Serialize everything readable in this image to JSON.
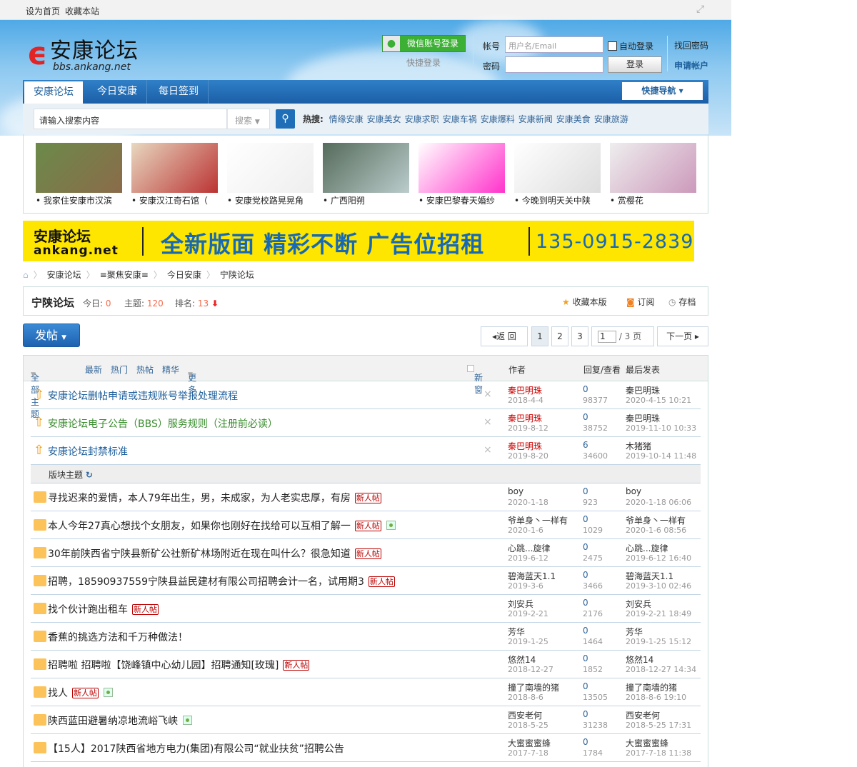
{
  "topbar": {
    "set_home": "设为首页",
    "bookmark": "收藏本站"
  },
  "logo": {
    "name": "安康论坛",
    "url": "bbs.ankang.net"
  },
  "login": {
    "wechat": "微信账号登录",
    "quick": "快捷登录",
    "account_label": "帐号",
    "account_placeholder": "用户名/Email",
    "password_label": "密码",
    "auto_login": "自动登录",
    "login_btn": "登录",
    "find_pw": "找回密码",
    "register": "申请帐户"
  },
  "nav": {
    "tabs": [
      "安康论坛",
      "今日安康",
      "每日签到"
    ],
    "quick_nav": "快捷导航"
  },
  "search": {
    "placeholder": "请输入搜索内容",
    "type": "搜索",
    "hot_label": "热搜:",
    "hot": [
      "情缘安康",
      "安康美女",
      "安康求职",
      "安康车祸",
      "安康爆料",
      "安康新闻",
      "安康美食",
      "安康旅游"
    ]
  },
  "slides": [
    "我家住安康市汉滨",
    "安康汉江奇石馆（",
    "安康党校路晃晃角",
    "广西阳朔",
    "安康巴黎春天婚纱",
    "今晚到明天关中陕",
    "赏樱花"
  ],
  "ad": {
    "logo": "安康论坛",
    "logo_url": "ankang.net",
    "text": "全新版面  精彩不断  广告位招租",
    "phone": "135-0915-2839"
  },
  "breadcrumb": [
    "安康论坛",
    "≡聚焦安康≡",
    "今日安康",
    "宁陕论坛"
  ],
  "forum": {
    "name": "宁陕论坛",
    "today_label": "今日:",
    "today": "0",
    "topics_label": "主题:",
    "topics": "120",
    "rank_label": "排名:",
    "rank": "13",
    "fav": "收藏本版",
    "rss": "订阅",
    "archive": "存档"
  },
  "post_btn": "发帖",
  "pager": {
    "back": "返 回",
    "pages": [
      "1",
      "2",
      "3"
    ],
    "current": "1",
    "total": "/ 3 页",
    "next": "下一页"
  },
  "thead": {
    "filters": [
      "全部主题",
      "最新",
      "热门",
      "热帖",
      "精华",
      "更多"
    ],
    "new_window": "新窗",
    "author": "作者",
    "replies": "回复/查看",
    "last": "最后发表"
  },
  "section_label": "版块主题",
  "sticky": [
    {
      "title": "安康论坛删帖申请或违规账号举报处理流程",
      "style": "hl",
      "author": "秦巴明珠",
      "date": "2018-4-4",
      "replies": "0",
      "views": "98377",
      "last_user": "秦巴明珠",
      "last_time": "2020-4-15 10:21"
    },
    {
      "title": "安康论坛电子公告（BBS）服务规则（注册前必读）",
      "style": "gr",
      "author": "秦巴明珠",
      "date": "2019-8-12",
      "replies": "0",
      "views": "38752",
      "last_user": "秦巴明珠",
      "last_time": "2019-11-10 10:33"
    },
    {
      "title": "安康论坛封禁标准",
      "style": "hl",
      "author": "秦巴明珠",
      "date": "2019-8-20",
      "replies": "6",
      "views": "34600",
      "last_user": "木猪猪",
      "last_time": "2019-10-14 11:48"
    }
  ],
  "new_badge": "新人帖",
  "threads": [
    {
      "title": "寻找迟来的爱情，本人79年出生，男，未成家，为人老实忠厚，有房",
      "new": true,
      "img": false,
      "author": "boy",
      "date": "2020-1-18",
      "replies": "0",
      "views": "923",
      "last_user": "boy",
      "last_time": "2020-1-18 06:06"
    },
    {
      "title": "本人今年27真心想找个女朋友，如果你也刚好在找给可以互相了解一",
      "new": true,
      "img": true,
      "author": "爷单身丶一样有",
      "date": "2020-1-6",
      "replies": "0",
      "views": "1029",
      "last_user": "爷单身丶一样有",
      "last_time": "2020-1-6 08:56"
    },
    {
      "title": "30年前陕西省宁陕县新矿公社新矿林场附近在现在叫什么？很急知道",
      "new": true,
      "img": false,
      "author": "心跳...旋律",
      "date": "2019-6-12",
      "replies": "0",
      "views": "2475",
      "last_user": "心跳...旋律",
      "last_time": "2019-6-12 16:40"
    },
    {
      "title": "招聘，18590937559宁陕县益民建材有限公司招聘会计一名，试用期3",
      "new": true,
      "img": false,
      "author": "碧海蓝天1.1",
      "date": "2019-3-6",
      "replies": "0",
      "views": "3466",
      "last_user": "碧海蓝天1.1",
      "last_time": "2019-3-10 02:46"
    },
    {
      "title": "找个伙计跑出租车",
      "new": true,
      "img": false,
      "author": "刘安兵",
      "date": "2019-2-21",
      "replies": "0",
      "views": "2176",
      "last_user": "刘安兵",
      "last_time": "2019-2-21 18:49"
    },
    {
      "title": "香蕉的挑选方法和千万种做法！",
      "new": false,
      "img": false,
      "author": "芳华",
      "date": "2019-1-25",
      "replies": "0",
      "views": "1464",
      "last_user": "芳华",
      "last_time": "2019-1-25 15:12"
    },
    {
      "title": "招聘啦 招聘啦【饶峰镇中心幼儿园】招聘通知[玫瑰]",
      "new": true,
      "img": false,
      "author": "悠然14",
      "date": "2018-12-27",
      "replies": "0",
      "views": "1852",
      "last_user": "悠然14",
      "last_time": "2018-12-27 14:34"
    },
    {
      "title": "找人",
      "new": true,
      "img": true,
      "author": "撞了南墙的猪",
      "date": "2018-8-6",
      "replies": "0",
      "views": "13505",
      "last_user": "撞了南墙的猪",
      "last_time": "2018-8-6 19:10"
    },
    {
      "title": "陕西蓝田避暑纳凉地流峪飞峡",
      "new": false,
      "img": true,
      "author": "西安老何",
      "date": "2018-5-25",
      "replies": "0",
      "views": "31238",
      "last_user": "西安老何",
      "last_time": "2018-5-25 17:31"
    },
    {
      "title": "【15人】2017陕西省地方电力(集团)有限公司“就业扶贫”招聘公告",
      "new": false,
      "img": false,
      "author": "大蜜蜜蜜蜂",
      "date": "2017-7-18",
      "replies": "0",
      "views": "1784",
      "last_user": "大蜜蜜蜜蜂",
      "last_time": "2017-7-18 11:38"
    }
  ]
}
